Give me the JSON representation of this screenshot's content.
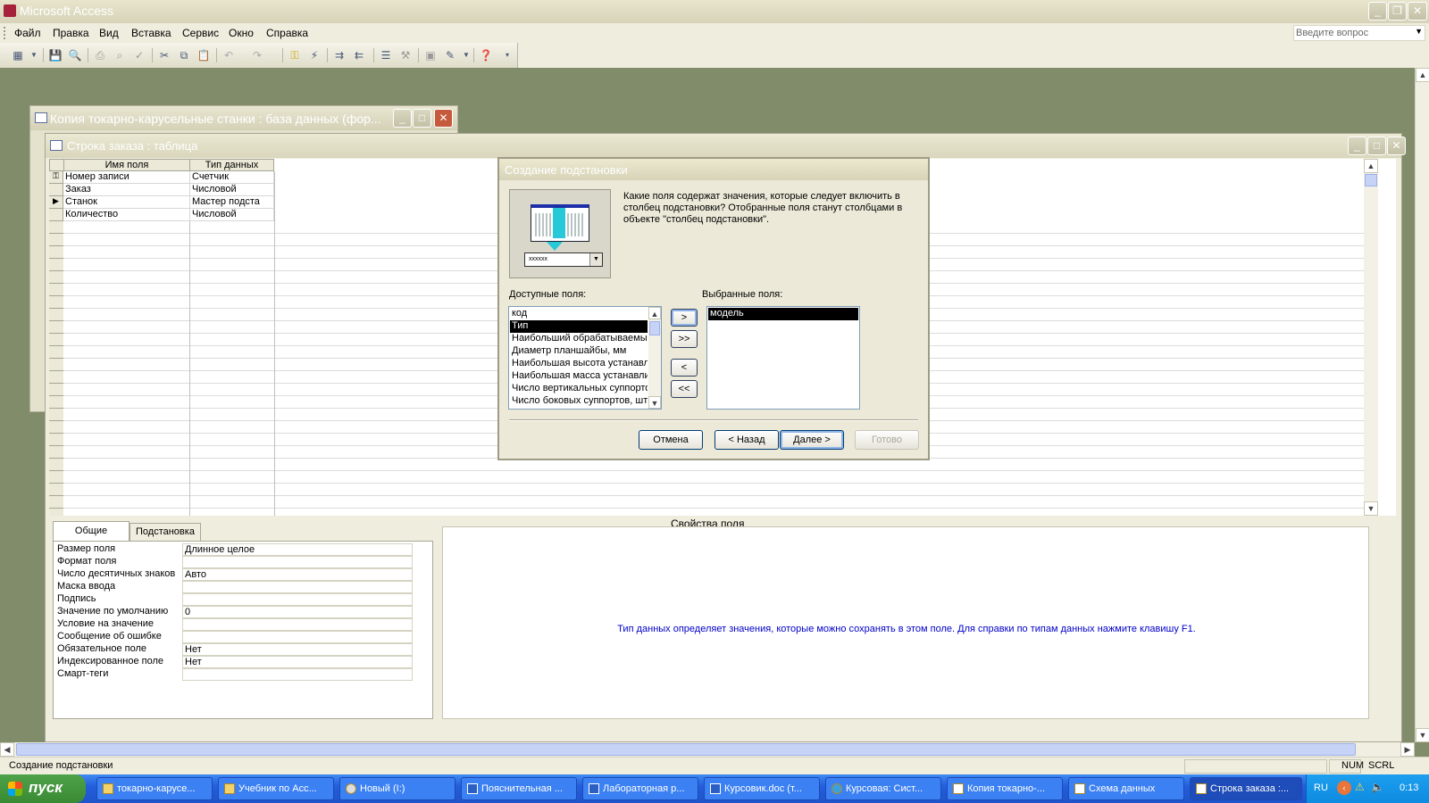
{
  "app": {
    "title": "Microsoft Access"
  },
  "menu": {
    "items": [
      "Файл",
      "Правка",
      "Вид",
      "Вставка",
      "Сервис",
      "Окно",
      "Справка"
    ],
    "ask_placeholder": "Введите вопрос"
  },
  "db_window": {
    "title": "Копия токарно-карусельные станки : база данных (фор..."
  },
  "table_window": {
    "title": "Строка заказа : таблица",
    "columns": [
      "Имя поля",
      "Тип данных"
    ],
    "rows": [
      {
        "name": "Номер записи",
        "type": "Счетчик"
      },
      {
        "name": "Заказ",
        "type": "Числовой"
      },
      {
        "name": "Станок",
        "type": "Мастер подста"
      },
      {
        "name": "Количество",
        "type": "Числовой"
      }
    ],
    "props_label": "Свойства поля",
    "tabs": [
      "Общие",
      "Подстановка"
    ],
    "properties": [
      {
        "label": "Размер поля",
        "value": "Длинное целое"
      },
      {
        "label": "Формат поля",
        "value": ""
      },
      {
        "label": "Число десятичных знаков",
        "value": "Авто"
      },
      {
        "label": "Маска ввода",
        "value": ""
      },
      {
        "label": "Подпись",
        "value": ""
      },
      {
        "label": "Значение по умолчанию",
        "value": "0"
      },
      {
        "label": "Условие на значение",
        "value": ""
      },
      {
        "label": "Сообщение об ошибке",
        "value": ""
      },
      {
        "label": "Обязательное поле",
        "value": "Нет"
      },
      {
        "label": "Индексированное поле",
        "value": "Нет"
      },
      {
        "label": "Смарт-теги",
        "value": ""
      }
    ],
    "help_text": "Тип данных определяет значения, которые можно сохранять в этом поле.  Для справки по типам данных нажмите клавишу F1."
  },
  "dialog": {
    "title": "Создание подстановки",
    "question": "Какие поля содержат значения, которые следует включить в столбец подстановки? Отобранные поля станут столбцами в объекте \"столбец подстановки\".",
    "available_label": "Доступные поля:",
    "selected_label": "Выбранные поля:",
    "available": [
      "код",
      "Тип",
      "Наибольший обрабатываемый",
      "Диаметр планшайбы, мм",
      "Наибольшая высота устанавл",
      "Наибольшая масса устанавлие",
      "Число вертикальных суппорто",
      "Число боковых суппортов, шт"
    ],
    "selected": [
      "модель"
    ],
    "move_buttons": [
      ">",
      ">>",
      "<",
      "<<"
    ],
    "buttons": {
      "cancel": "Отмена",
      "back": "< Назад",
      "next": "Далее >",
      "finish": "Готово"
    }
  },
  "statusbar": {
    "text": "Создание подстановки",
    "num": "NUM",
    "scrl": "SCRL"
  },
  "taskbar": {
    "start": "пуск",
    "tasks": [
      "токарно-карусе...",
      "Учебник по Acc...",
      "Новый (I:)",
      "Пояснительная ...",
      "Лабораторная р...",
      "Курсовик.doc (т...",
      "Курсовая: Сист...",
      "Копия токарно-...",
      "Схема данных",
      "Строка заказа :..."
    ],
    "lang": "RU",
    "clock": "0:13"
  },
  "colors": {
    "help_text": "#0000c8",
    "taskbar": "#245edb",
    "start": "#3a8a33"
  }
}
